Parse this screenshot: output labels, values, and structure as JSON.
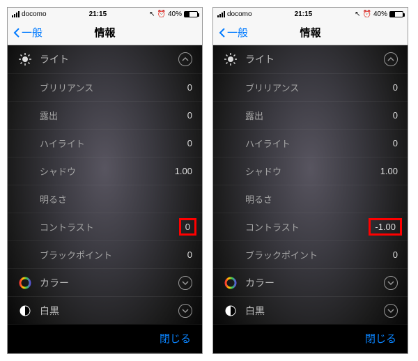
{
  "statusbar": {
    "carrier": "docomo",
    "time": "21:15",
    "battery_pct": "40%"
  },
  "navbar": {
    "back": "一般",
    "title": "情報"
  },
  "light": {
    "label": "ライト",
    "items": [
      {
        "label": "ブリリアンス",
        "val": "0"
      },
      {
        "label": "露出",
        "val": "0"
      },
      {
        "label": "ハイライト",
        "val": "0"
      },
      {
        "label": "シャドウ",
        "val": "1.00"
      },
      {
        "label": "明るさ"
      },
      {
        "label": "コントラスト",
        "val_left": "0",
        "val_right": "-1.00"
      },
      {
        "label": "ブラックポイント",
        "val": "0"
      }
    ]
  },
  "color": {
    "label": "カラー"
  },
  "bw": {
    "label": "白黒"
  },
  "close": "閉じる"
}
